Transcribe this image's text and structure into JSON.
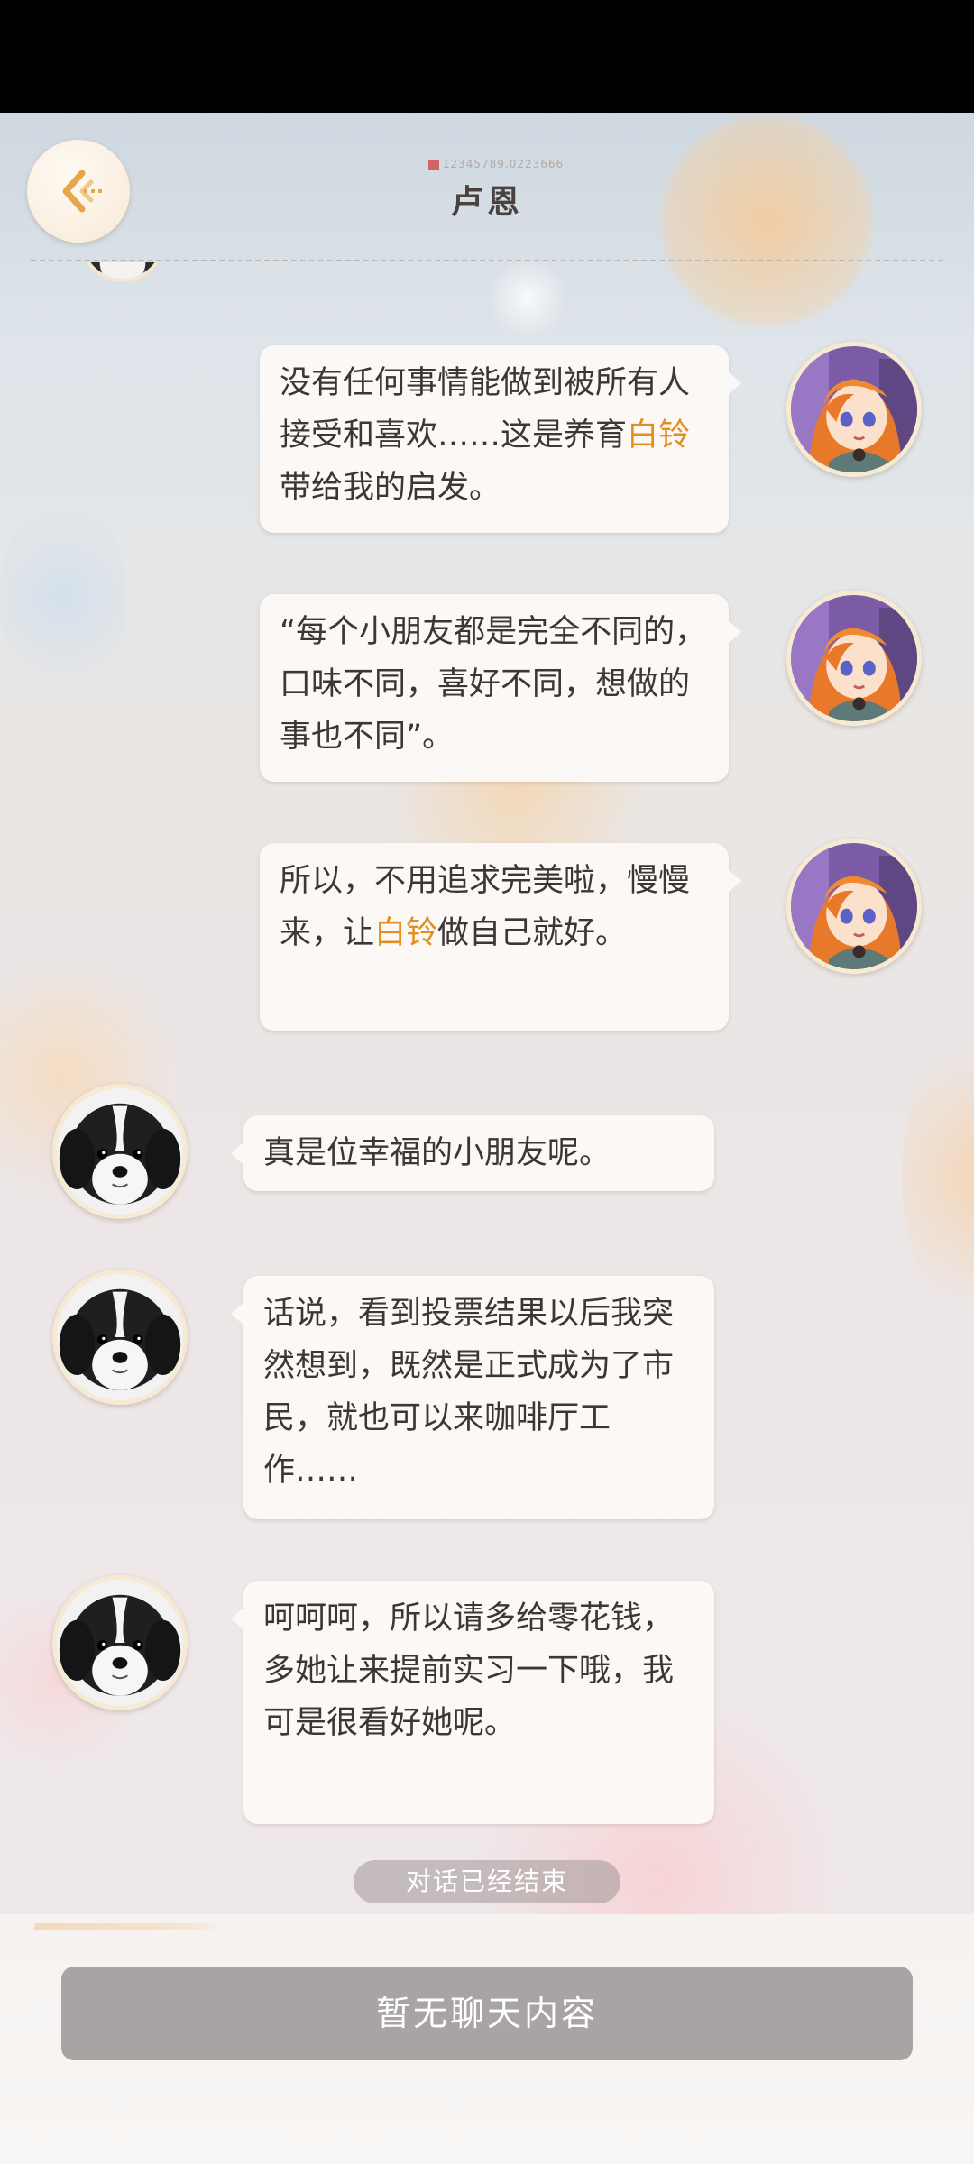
{
  "header": {
    "title": "卢恩",
    "subtitle_code": "12345789.0223666"
  },
  "messages": [
    {
      "side": "right",
      "speaker": "girl",
      "parts": [
        {
          "t": "没有任何事情能做到被所"
        },
        {
          "t": "有人接受和喜欢……这是"
        },
        {
          "t": "养育"
        },
        {
          "t": "白铃",
          "hl": true
        },
        {
          "t": "带给我的启发。"
        }
      ]
    },
    {
      "side": "right",
      "speaker": "girl",
      "parts": [
        {
          "t": "“每个小朋友都是完全不"
        },
        {
          "t": "同的，口味不同，喜好不"
        },
        {
          "t": "同，想做的事也不同”。"
        }
      ]
    },
    {
      "side": "right",
      "speaker": "girl",
      "parts": [
        {
          "t": "所以，不用追求完美啦，"
        },
        {
          "t": "慢慢来，让"
        },
        {
          "t": "白铃",
          "hl": true
        },
        {
          "t": "做自己就"
        },
        {
          "t": "好。"
        }
      ]
    },
    {
      "side": "left",
      "speaker": "dog",
      "parts": [
        {
          "t": "真是位幸福的小朋友呢。"
        }
      ]
    },
    {
      "side": "left",
      "speaker": "dog",
      "parts": [
        {
          "t": "话说，看到投票结果以后"
        },
        {
          "t": "我突然想到，既然是正式"
        },
        {
          "t": "成为了市民，就也可以来"
        },
        {
          "t": "咖啡厅工作……"
        }
      ]
    },
    {
      "side": "left",
      "speaker": "dog",
      "parts": [
        {
          "t": "呵呵呵，所以请多给零花"
        },
        {
          "t": "钱，多她让来提前实习一"
        },
        {
          "t": "下哦，我可是很看好她"
        },
        {
          "t": "呢。"
        }
      ]
    }
  ],
  "status": {
    "ended_label": "对话已经结束"
  },
  "footer": {
    "input_label": "暂无聊天内容"
  },
  "colors": {
    "highlight": "#e1901f",
    "bubble": "#fbf8f5",
    "text": "#3d3634"
  },
  "icons": {
    "back": "chevron-left-icon",
    "girl_avatar": "orange-hair-girl-avatar",
    "dog_avatar": "dog-avatar"
  }
}
